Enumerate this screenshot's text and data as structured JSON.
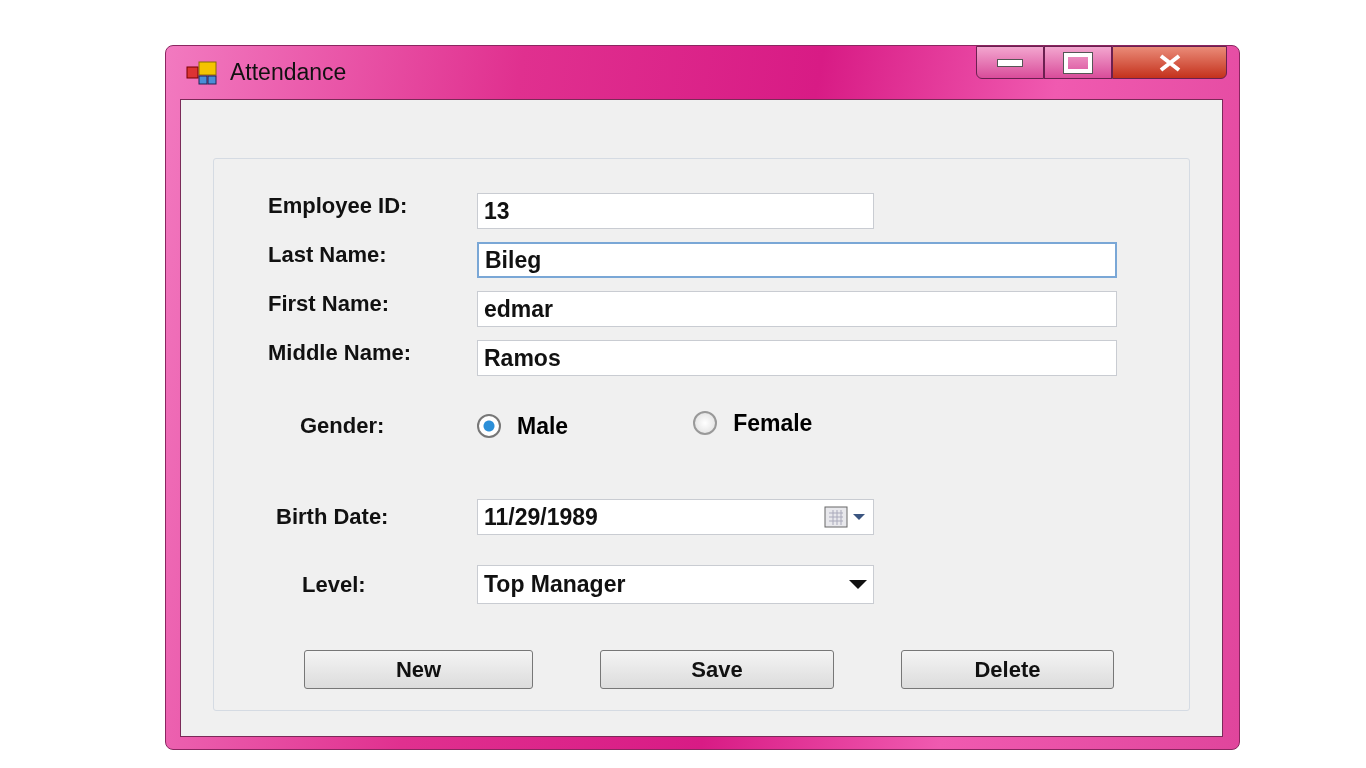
{
  "window": {
    "title": "Attendance"
  },
  "fields": [
    {
      "label": "Employee ID:",
      "value": "13",
      "focused": false
    },
    {
      "label": "Last Name:",
      "value": "Bileg",
      "focused": true
    },
    {
      "label": "First Name:",
      "value": "edmar",
      "focused": false
    },
    {
      "label": "Middle Name:",
      "value": "Ramos",
      "focused": false
    }
  ],
  "gender": {
    "label": "Gender:",
    "options": [
      {
        "label": "Male",
        "selected": true
      },
      {
        "label": "Female",
        "selected": false
      }
    ]
  },
  "birth_date": {
    "label": "Birth Date:",
    "value": "11/29/1989"
  },
  "level": {
    "label": "Level:",
    "value": "Top Manager"
  },
  "buttons": [
    "New",
    "Save",
    "Delete"
  ]
}
